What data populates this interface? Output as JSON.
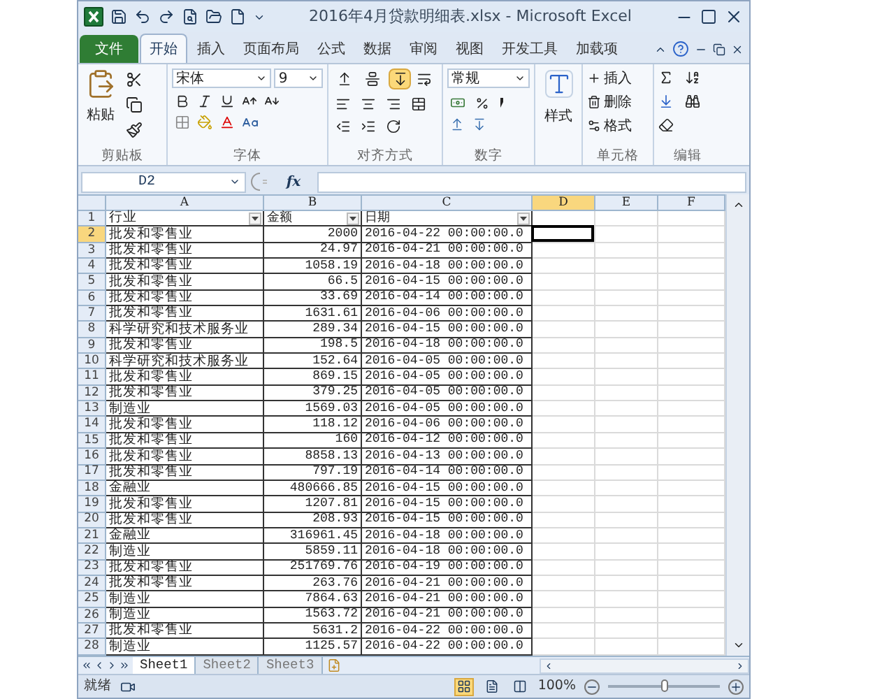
{
  "window": {
    "title": "2016年4月贷款明细表.xlsx - Microsoft Excel"
  },
  "file_tab": "文件",
  "tabs": [
    {
      "label": "开始",
      "selected": true
    },
    {
      "label": "插入",
      "selected": false
    },
    {
      "label": "页面布局",
      "selected": false
    },
    {
      "label": "公式",
      "selected": false
    },
    {
      "label": "数据",
      "selected": false
    },
    {
      "label": "审阅",
      "selected": false
    },
    {
      "label": "视图",
      "selected": false
    },
    {
      "label": "开发工具",
      "selected": false
    },
    {
      "label": "加载项",
      "selected": false
    }
  ],
  "ribbon": {
    "clipboard": {
      "paste": "粘贴",
      "label": "剪贴板"
    },
    "font": {
      "name": "宋体",
      "size": "9",
      "label": "字体"
    },
    "alignment": {
      "vertical": [
        {
          "kind": "top",
          "selected": false
        },
        {
          "kind": "middle",
          "selected": false
        },
        {
          "kind": "bottom",
          "selected": true
        }
      ],
      "label": "对齐方式"
    },
    "number": {
      "format": "常规",
      "label": "数字"
    },
    "styles": {
      "button": "样式"
    },
    "cells": {
      "buttons": [
        "插入",
        "删除",
        "格式"
      ],
      "label": "单元格"
    },
    "editing": {
      "label": "编辑"
    }
  },
  "formula_bar": {
    "name_box": "D2",
    "function_label": "fx"
  },
  "columns": [
    {
      "label": "A",
      "selected": false
    },
    {
      "label": "B",
      "selected": false
    },
    {
      "label": "C",
      "selected": false
    },
    {
      "label": "D",
      "selected": true
    },
    {
      "label": "E",
      "selected": false
    },
    {
      "label": "F",
      "selected": false
    }
  ],
  "rows": [
    {
      "kind": "header",
      "number": "1",
      "selected": false,
      "cells": [
        "行业",
        "金额",
        "日期"
      ]
    },
    {
      "kind": "data",
      "number": "2",
      "selected": true,
      "cells": [
        "批发和零售业",
        "2000",
        "2016-04-22 00:00:00.0"
      ]
    },
    {
      "kind": "data",
      "number": "3",
      "selected": false,
      "cells": [
        "批发和零售业",
        "24.97",
        "2016-04-21 00:00:00.0"
      ]
    },
    {
      "kind": "data",
      "number": "4",
      "selected": false,
      "cells": [
        "批发和零售业",
        "1058.19",
        "2016-04-18 00:00:00.0"
      ]
    },
    {
      "kind": "data",
      "number": "5",
      "selected": false,
      "cells": [
        "批发和零售业",
        "66.5",
        "2016-04-15 00:00:00.0"
      ]
    },
    {
      "kind": "data",
      "number": "6",
      "selected": false,
      "cells": [
        "批发和零售业",
        "33.69",
        "2016-04-14 00:00:00.0"
      ]
    },
    {
      "kind": "data",
      "number": "7",
      "selected": false,
      "cells": [
        "批发和零售业",
        "1631.61",
        "2016-04-06 00:00:00.0"
      ]
    },
    {
      "kind": "data",
      "number": "8",
      "selected": false,
      "cells": [
        "科学研究和技术服务业",
        "289.34",
        "2016-04-15 00:00:00.0"
      ]
    },
    {
      "kind": "data",
      "number": "9",
      "selected": false,
      "cells": [
        "批发和零售业",
        "198.5",
        "2016-04-18 00:00:00.0"
      ]
    },
    {
      "kind": "data",
      "number": "10",
      "selected": false,
      "cells": [
        "科学研究和技术服务业",
        "152.64",
        "2016-04-05 00:00:00.0"
      ]
    },
    {
      "kind": "data",
      "number": "11",
      "selected": false,
      "cells": [
        "批发和零售业",
        "869.15",
        "2016-04-05 00:00:00.0"
      ]
    },
    {
      "kind": "data",
      "number": "12",
      "selected": false,
      "cells": [
        "批发和零售业",
        "379.25",
        "2016-04-05 00:00:00.0"
      ]
    },
    {
      "kind": "data",
      "number": "13",
      "selected": false,
      "cells": [
        "制造业",
        "1569.03",
        "2016-04-05 00:00:00.0"
      ]
    },
    {
      "kind": "data",
      "number": "14",
      "selected": false,
      "cells": [
        "批发和零售业",
        "118.12",
        "2016-04-06 00:00:00.0"
      ]
    },
    {
      "kind": "data",
      "number": "15",
      "selected": false,
      "cells": [
        "批发和零售业",
        "160",
        "2016-04-12 00:00:00.0"
      ]
    },
    {
      "kind": "data",
      "number": "16",
      "selected": false,
      "cells": [
        "批发和零售业",
        "8858.13",
        "2016-04-13 00:00:00.0"
      ]
    },
    {
      "kind": "data",
      "number": "17",
      "selected": false,
      "cells": [
        "批发和零售业",
        "797.19",
        "2016-04-14 00:00:00.0"
      ]
    },
    {
      "kind": "data",
      "number": "18",
      "selected": false,
      "cells": [
        "金融业",
        "480666.85",
        "2016-04-15 00:00:00.0"
      ]
    },
    {
      "kind": "data",
      "number": "19",
      "selected": false,
      "cells": [
        "批发和零售业",
        "1207.81",
        "2016-04-15 00:00:00.0"
      ]
    },
    {
      "kind": "data",
      "number": "20",
      "selected": false,
      "cells": [
        "批发和零售业",
        "208.93",
        "2016-04-15 00:00:00.0"
      ]
    },
    {
      "kind": "data",
      "number": "21",
      "selected": false,
      "cells": [
        "金融业",
        "316961.45",
        "2016-04-18 00:00:00.0"
      ]
    },
    {
      "kind": "data",
      "number": "22",
      "selected": false,
      "cells": [
        "制造业",
        "5859.11",
        "2016-04-18 00:00:00.0"
      ]
    },
    {
      "kind": "data",
      "number": "23",
      "selected": false,
      "cells": [
        "批发和零售业",
        "251769.76",
        "2016-04-19 00:00:00.0"
      ]
    },
    {
      "kind": "data",
      "number": "24",
      "selected": false,
      "cells": [
        "批发和零售业",
        "263.76",
        "2016-04-21 00:00:00.0"
      ]
    },
    {
      "kind": "data",
      "number": "25",
      "selected": false,
      "cells": [
        "制造业",
        "7864.63",
        "2016-04-21 00:00:00.0"
      ]
    },
    {
      "kind": "data",
      "number": "26",
      "selected": false,
      "cells": [
        "制造业",
        "1563.72",
        "2016-04-21 00:00:00.0"
      ]
    },
    {
      "kind": "data",
      "number": "27",
      "selected": false,
      "cells": [
        "批发和零售业",
        "5631.2",
        "2016-04-22 00:00:00.0"
      ]
    },
    {
      "kind": "data",
      "number": "28",
      "selected": false,
      "cells": [
        "制造业",
        "1125.57",
        "2016-04-22 00:00:00.0"
      ]
    }
  ],
  "sheets": [
    {
      "label": "Sheet1",
      "selected": true
    },
    {
      "label": "Sheet2",
      "selected": false
    },
    {
      "label": "Sheet3",
      "selected": false
    }
  ],
  "status_bar": {
    "status": "就绪",
    "views": [
      {
        "kind": "normal",
        "selected": true
      },
      {
        "kind": "layout",
        "selected": false
      },
      {
        "kind": "page_break",
        "selected": false
      }
    ],
    "zoom": "100%",
    "zoom_slider": {
      "level": 0.5
    }
  }
}
